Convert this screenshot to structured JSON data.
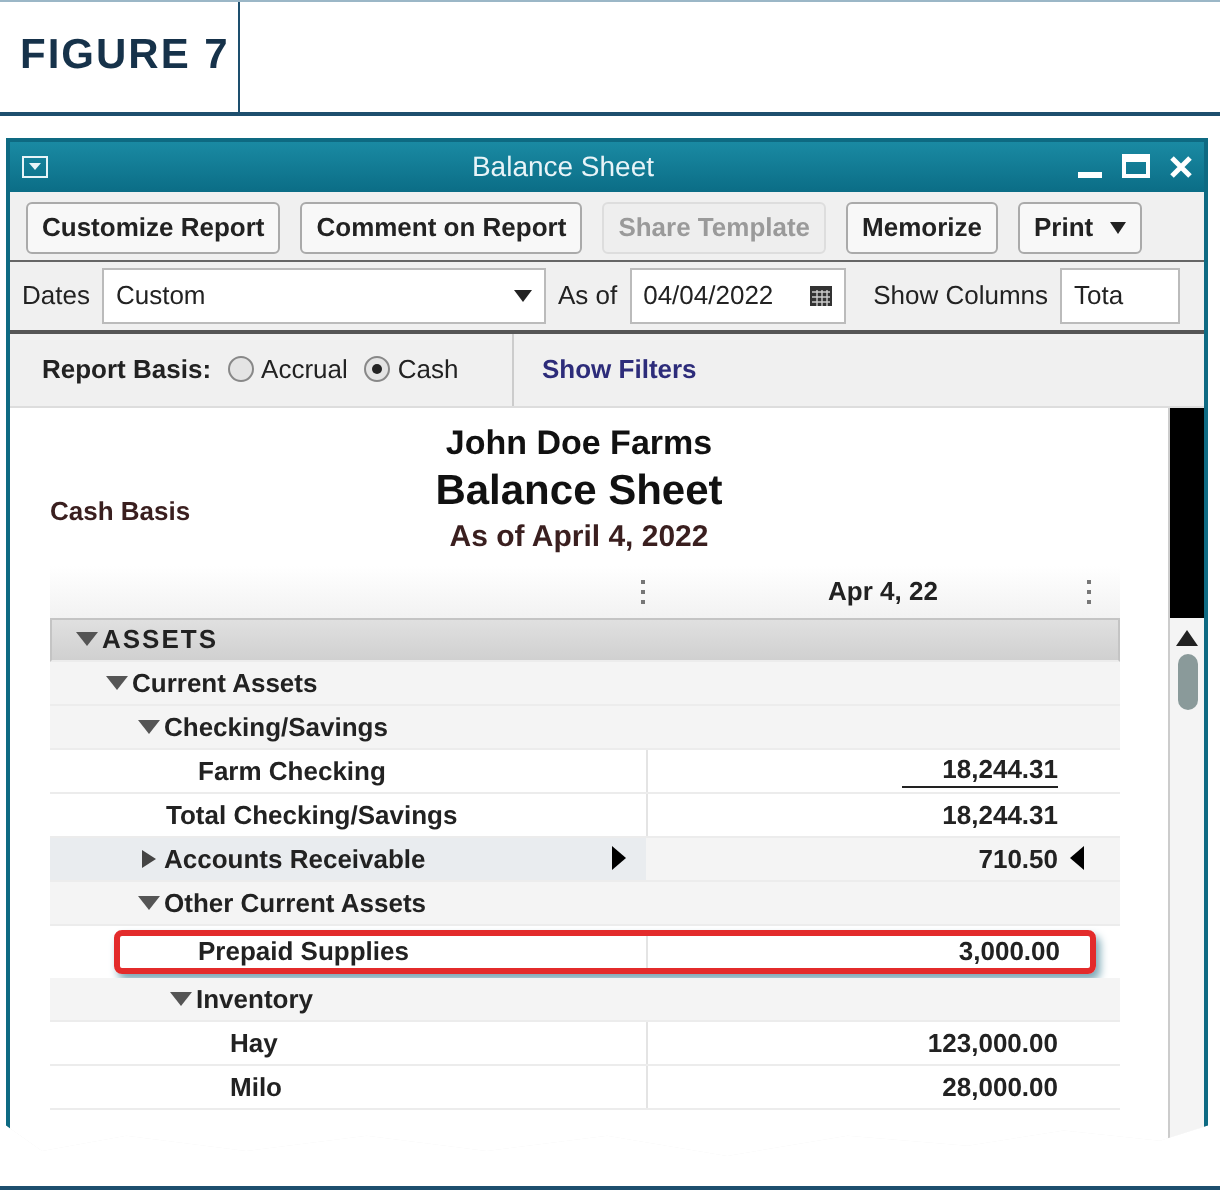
{
  "figure": {
    "label": "FIGURE 7"
  },
  "window": {
    "title": "Balance Sheet"
  },
  "toolbar": {
    "buttons": [
      {
        "label": "Customize Report",
        "disabled": false
      },
      {
        "label": "Comment on Report",
        "disabled": false
      },
      {
        "label": "Share Template",
        "disabled": true
      },
      {
        "label": "Memorize",
        "disabled": false
      },
      {
        "label": "Print",
        "disabled": false
      }
    ]
  },
  "filters": {
    "dates_label": "Dates",
    "dates_value": "Custom",
    "as_of_label": "As of",
    "as_of_value": "04/04/2022",
    "columns_label": "Show Columns",
    "columns_value": "Tota"
  },
  "basis": {
    "label": "Report Basis:",
    "options": [
      {
        "label": "Accrual",
        "selected": false
      },
      {
        "label": "Cash",
        "selected": true
      }
    ],
    "show_filters": "Show Filters"
  },
  "report": {
    "company": "John Doe Farms",
    "title": "Balance Sheet",
    "date": "As of April 4, 2022",
    "basis": "Cash Basis",
    "column": "Apr 4, 22",
    "rows": [
      {
        "label": "ASSETS",
        "expanded": true,
        "selected": false,
        "children": [
          {
            "label": "Current Assets",
            "expanded": true,
            "selected": false,
            "children": [
              {
                "label": "Checking/Savings",
                "expanded": true,
                "selected": false,
                "children": [
                  {
                    "label": "Farm Checking",
                    "amount": "18,244.31",
                    "underline": true,
                    "selected": false,
                    "highlighted": false
                  }
                ]
              },
              {
                "label": "Total Checking/Savings",
                "amount": "18,244.31",
                "underline": false,
                "selected": false,
                "highlighted": false
              },
              {
                "label": "Accounts Receivable",
                "expanded": false,
                "amount": "710.50",
                "underline": false,
                "selected": true,
                "highlighted": false
              },
              {
                "label": "Other Current Assets",
                "expanded": true,
                "selected": false,
                "children": [
                  {
                    "label": "Prepaid Supplies",
                    "amount": "3,000.00",
                    "underline": false,
                    "selected": false,
                    "highlighted": true
                  },
                  {
                    "label": "Inventory",
                    "expanded": true,
                    "selected": false,
                    "children": [
                      {
                        "label": "Hay",
                        "amount": "123,000.00",
                        "underline": false,
                        "selected": false,
                        "highlighted": false
                      },
                      {
                        "label": "Milo",
                        "amount": "28,000.00",
                        "underline": false,
                        "selected": false,
                        "highlighted": false
                      }
                    ]
                  }
                ]
              }
            ]
          }
        ]
      }
    ]
  }
}
